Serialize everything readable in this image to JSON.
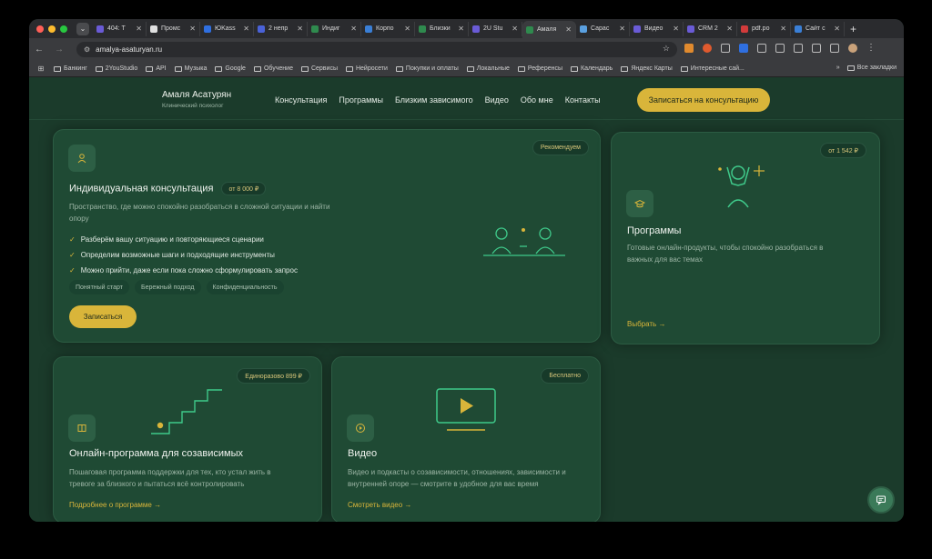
{
  "browser": {
    "tabs": [
      {
        "label": "404: T",
        "color": "#6a5bd6",
        "active": false
      },
      {
        "label": "Промс",
        "color": "#e0e0e0",
        "active": false
      },
      {
        "label": "ЮKass",
        "color": "#2f6fe0",
        "active": false
      },
      {
        "label": "2 непр",
        "color": "#4a62d8",
        "active": false
      },
      {
        "label": "Индиг",
        "color": "#2f8a4e",
        "active": false
      },
      {
        "label": "Корпо",
        "color": "#3a7fd6",
        "active": false
      },
      {
        "label": "Близки",
        "color": "#2f8a4e",
        "active": false
      },
      {
        "label": "2U Stu",
        "color": "#6a5bd6",
        "active": false
      },
      {
        "label": "Амаля",
        "color": "#2f8a4e",
        "active": true
      },
      {
        "label": "Сарас",
        "color": "#5aa0e0",
        "active": false
      },
      {
        "label": "Видео",
        "color": "#6a5bd6",
        "active": false
      },
      {
        "label": "CRM 2",
        "color": "#6a5bd6",
        "active": false
      },
      {
        "label": "pdf.po",
        "color": "#d23b3b",
        "active": false
      },
      {
        "label": "Сайт с",
        "color": "#3a7fd6",
        "active": false
      }
    ],
    "new_tab": "+",
    "close_glyph": "✕",
    "url": "amalya-asaturyan.ru",
    "bookmarks": [
      "Банкинг",
      "2YouStudio",
      "API",
      "Музыка",
      "Google",
      "Обучение",
      "Сервисы",
      "Нейросети",
      "Покупки и оплаты",
      "Локальные",
      "Референсы",
      "Календарь",
      "Яндекс Карты",
      "Интересные сай..."
    ],
    "bookmarks_more": "»",
    "all_bookmarks": "Все закладки"
  },
  "header": {
    "name": "Амаля Асатурян",
    "role": "Клинический психолог",
    "nav": [
      "Консультация",
      "Программы",
      "Близким зависимого",
      "Видео",
      "Обо мне",
      "Контакты"
    ],
    "cta": "Записаться на консультацию"
  },
  "consult": {
    "badge": "Рекомендуем",
    "title": "Индивидуальная консультация",
    "price": "от 8 000 ₽",
    "desc": "Пространство, где можно спокойно разобраться в сложной ситуации и найти опору",
    "checks": [
      "Разберём вашу ситуацию и повторяющиеся сценарии",
      "Определим возможные шаги и подходящие инструменты",
      "Можно прийти, даже если пока сложно сформулировать запрос"
    ],
    "pills": [
      "Понятный старт",
      "Бережный подход",
      "Конфиденциальность"
    ],
    "button": "Записаться"
  },
  "programs": {
    "badge": "от 1 542 ₽",
    "title": "Программы",
    "desc": "Готовые онлайн-продукты, чтобы спокойно разобраться в важных для вас темах",
    "link": "Выбрать →"
  },
  "online": {
    "badge": "Единоразово 899 ₽",
    "title": "Онлайн-программа для созависимых",
    "desc": "Пошаговая программа поддержки для тех, кто устал жить в тревоге за близкого и пытаться всё контролировать",
    "link": "Подробнее о программе →"
  },
  "video": {
    "badge": "Бесплатно",
    "title": "Видео",
    "desc": "Видео и подкасты о созависимости, отношениях, зависимости и внутренней опоре — смотрите в удобное для вас время"
  },
  "colors": {
    "accent": "#d9b53a",
    "background": "#1b3b2b",
    "card": "#1f4a34",
    "line": "#3fc98a"
  }
}
